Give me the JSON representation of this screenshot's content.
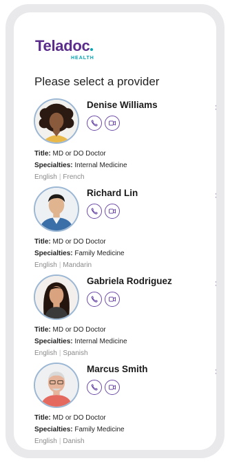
{
  "brand": {
    "name": "Teladoc",
    "sub": "HEALTH"
  },
  "page_title": "Please select a provider",
  "labels": {
    "title": "Title:",
    "specialties": "Specialties:"
  },
  "colors": {
    "brand_purple": "#5a2c8c",
    "brand_teal": "#00a5b5",
    "icon_purple": "#6b4aa6"
  },
  "providers": [
    {
      "name": "Denise Williams",
      "title": "MD or DO Doctor",
      "specialty": "Internal Medicine",
      "languages": [
        "English",
        "French"
      ],
      "icons": [
        "phone-icon",
        "video-icon",
        "chevron-right-icon"
      ]
    },
    {
      "name": "Richard Lin",
      "title": "MD or DO Doctor",
      "specialty": "Family Medicine",
      "languages": [
        "English",
        "Mandarin"
      ],
      "icons": [
        "phone-icon",
        "video-icon",
        "chevron-right-icon"
      ]
    },
    {
      "name": "Gabriela Rodriguez",
      "title": "MD or DO Doctor",
      "specialty": "Internal Medicine",
      "languages": [
        "English",
        "Spanish"
      ],
      "icons": [
        "phone-icon",
        "video-icon",
        "chevron-right-icon"
      ]
    },
    {
      "name": "Marcus Smith",
      "title": "MD or DO Doctor",
      "specialty": "Family Medicine",
      "languages": [
        "English",
        "Danish"
      ],
      "icons": [
        "phone-icon",
        "video-icon",
        "chevron-right-icon"
      ]
    }
  ]
}
